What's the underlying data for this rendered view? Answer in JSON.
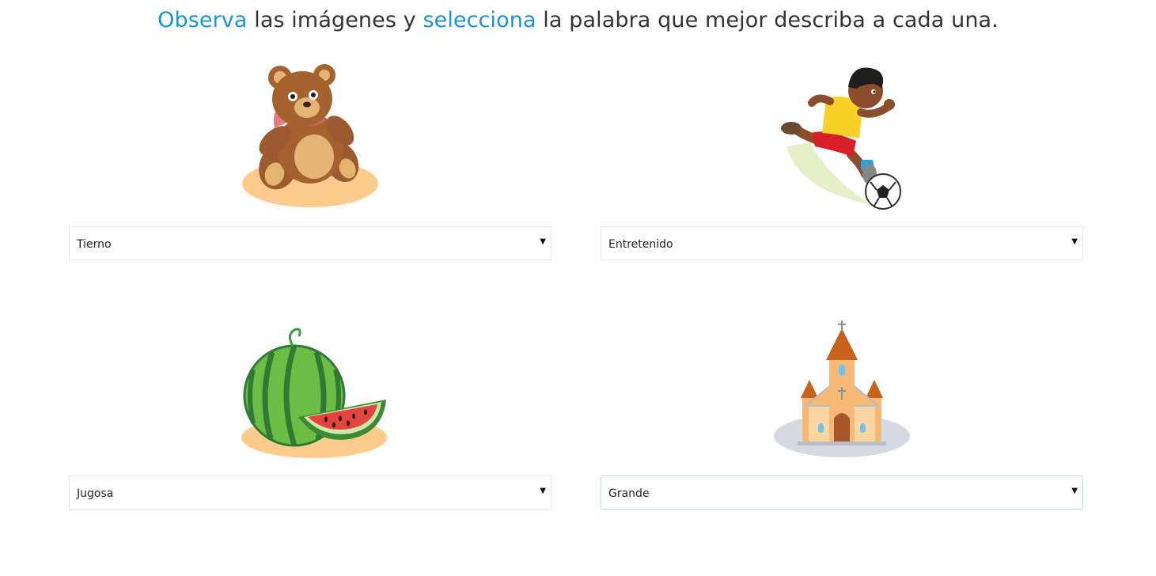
{
  "instruction": {
    "part1": "Observa",
    "part2": " las imágenes y ",
    "part3": "selecciona",
    "part4": " la palabra que mejor describa a cada una."
  },
  "colors": {
    "accent": "#1a94d3",
    "text": "#333333"
  },
  "items": [
    {
      "image": "teddy-bear",
      "selected": "Tierno"
    },
    {
      "image": "boy-playing-soccer",
      "selected": "Entretenido"
    },
    {
      "image": "watermelon",
      "selected": "Jugosa"
    },
    {
      "image": "church",
      "selected": "Grande"
    }
  ],
  "dropdown_icon": "triangle-down"
}
